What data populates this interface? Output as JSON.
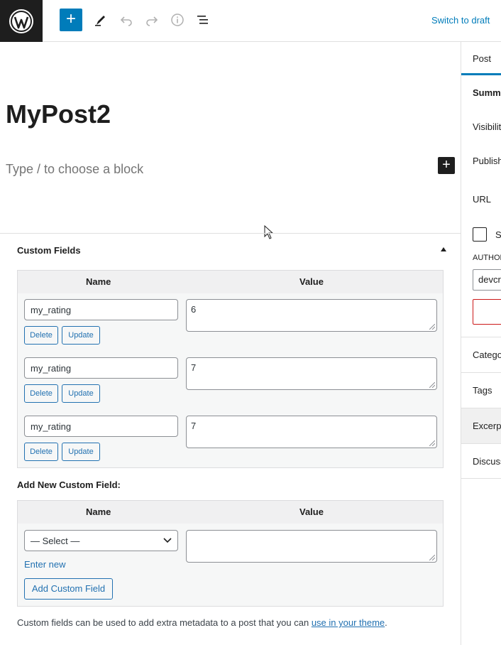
{
  "toolbar": {
    "logo_icon": "wordpress-logo-icon",
    "add_block_label": "+",
    "icons": [
      "edit-tool-icon",
      "undo-icon",
      "redo-icon",
      "details-info-icon",
      "list-view-icon"
    ],
    "switch_to_draft_label": "Switch to draft"
  },
  "editor": {
    "post_title": "MyPost2",
    "block_placeholder": "Type / to choose a block",
    "inline_add_label": "+"
  },
  "sidebar": {
    "tab_post": "Post",
    "summary_label": "Summa",
    "visibility_label": "Visibilit",
    "publish_label": "Publish",
    "url_label": "URL",
    "sticky_label": "St",
    "author_heading": "AUTHOR",
    "author_value": "devcr",
    "categories_label": "Catego",
    "tags_label": "Tags",
    "excerpt_label": "Excerpt",
    "discussion_label": "Discuss"
  },
  "custom_fields": {
    "title": "Custom Fields",
    "col_name": "Name",
    "col_value": "Value",
    "rows": [
      {
        "key": "my_rating",
        "value": "6",
        "delete_label": "Delete",
        "update_label": "Update"
      },
      {
        "key": "my_rating",
        "value": "7",
        "delete_label": "Delete",
        "update_label": "Update"
      },
      {
        "key": "my_rating",
        "value": "7",
        "delete_label": "Delete",
        "update_label": "Update"
      }
    ],
    "add_new_label": "Add New Custom Field:",
    "new_col_name": "Name",
    "new_col_value": "Value",
    "select_value": "— Select —",
    "new_value": "",
    "enter_new_label": "Enter new",
    "add_button_label": "Add Custom Field",
    "footer_text": "Custom fields can be used to add extra metadata to a post that you can ",
    "footer_link": "use in your theme",
    "footer_end": "."
  },
  "colors": {
    "accent": "#007cba",
    "link": "#2271b1",
    "dark": "#1e1e1e",
    "danger": "#cc1818"
  }
}
